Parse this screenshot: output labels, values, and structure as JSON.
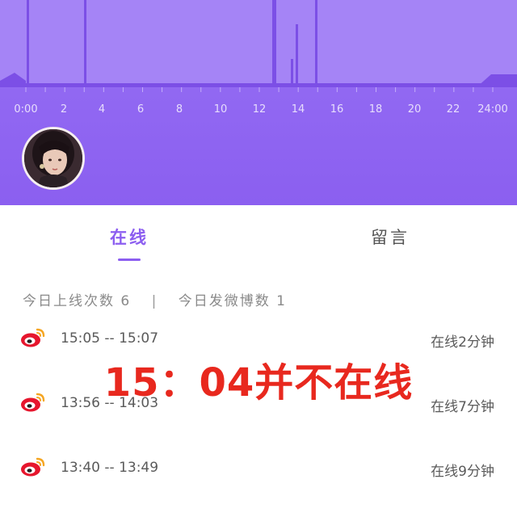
{
  "timeline": {
    "tick_labels": [
      "0:00",
      "2",
      "4",
      "6",
      "8",
      "10",
      "12",
      "14",
      "16",
      "18",
      "20",
      "22",
      "24:00"
    ],
    "bar_color": "#7c4fe6",
    "background_color": "#9b74f4"
  },
  "tabs": {
    "online_label": "在线",
    "message_label": "留言",
    "active": "online",
    "accent_color": "#8c5ef0"
  },
  "summary": {
    "online_count_text": "今日上线次数 6",
    "separator": "|",
    "post_count_text": "今日发微博数 1"
  },
  "sessions": [
    {
      "time_range": "15:05  --  15:07",
      "duration": "在线2分钟",
      "icon": "weibo-icon"
    },
    {
      "time_range": "13:56  --  14:03",
      "duration": "在线7分钟",
      "icon": "weibo-icon"
    },
    {
      "time_range": "13:40  --  13:49",
      "duration": "在线9分钟",
      "icon": "weibo-icon"
    }
  ],
  "overlay": {
    "text": "15：04并不在线",
    "color": "#e8281e"
  }
}
